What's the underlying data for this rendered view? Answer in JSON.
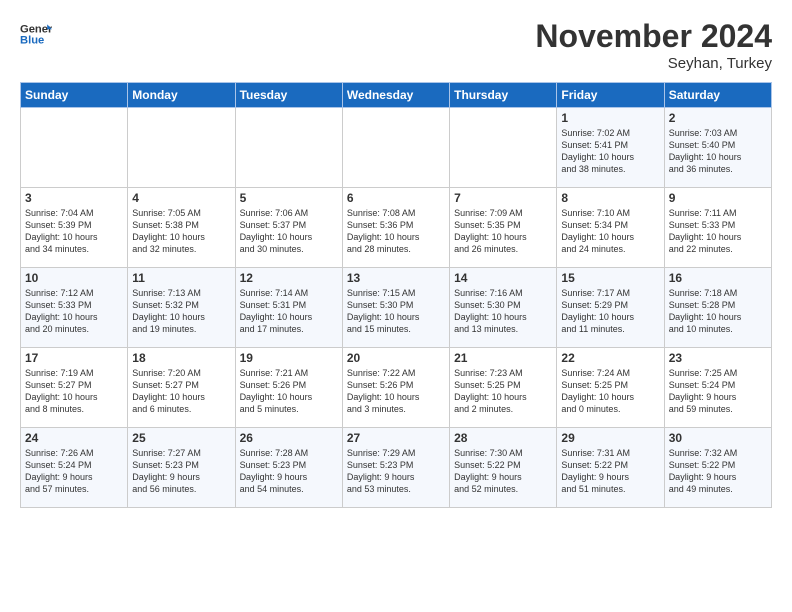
{
  "header": {
    "logo_line1": "General",
    "logo_line2": "Blue",
    "month_title": "November 2024",
    "subtitle": "Seyhan, Turkey"
  },
  "weekdays": [
    "Sunday",
    "Monday",
    "Tuesday",
    "Wednesday",
    "Thursday",
    "Friday",
    "Saturday"
  ],
  "weeks": [
    [
      {
        "day": "",
        "text": ""
      },
      {
        "day": "",
        "text": ""
      },
      {
        "day": "",
        "text": ""
      },
      {
        "day": "",
        "text": ""
      },
      {
        "day": "",
        "text": ""
      },
      {
        "day": "1",
        "text": "Sunrise: 7:02 AM\nSunset: 5:41 PM\nDaylight: 10 hours\nand 38 minutes."
      },
      {
        "day": "2",
        "text": "Sunrise: 7:03 AM\nSunset: 5:40 PM\nDaylight: 10 hours\nand 36 minutes."
      }
    ],
    [
      {
        "day": "3",
        "text": "Sunrise: 7:04 AM\nSunset: 5:39 PM\nDaylight: 10 hours\nand 34 minutes."
      },
      {
        "day": "4",
        "text": "Sunrise: 7:05 AM\nSunset: 5:38 PM\nDaylight: 10 hours\nand 32 minutes."
      },
      {
        "day": "5",
        "text": "Sunrise: 7:06 AM\nSunset: 5:37 PM\nDaylight: 10 hours\nand 30 minutes."
      },
      {
        "day": "6",
        "text": "Sunrise: 7:08 AM\nSunset: 5:36 PM\nDaylight: 10 hours\nand 28 minutes."
      },
      {
        "day": "7",
        "text": "Sunrise: 7:09 AM\nSunset: 5:35 PM\nDaylight: 10 hours\nand 26 minutes."
      },
      {
        "day": "8",
        "text": "Sunrise: 7:10 AM\nSunset: 5:34 PM\nDaylight: 10 hours\nand 24 minutes."
      },
      {
        "day": "9",
        "text": "Sunrise: 7:11 AM\nSunset: 5:33 PM\nDaylight: 10 hours\nand 22 minutes."
      }
    ],
    [
      {
        "day": "10",
        "text": "Sunrise: 7:12 AM\nSunset: 5:33 PM\nDaylight: 10 hours\nand 20 minutes."
      },
      {
        "day": "11",
        "text": "Sunrise: 7:13 AM\nSunset: 5:32 PM\nDaylight: 10 hours\nand 19 minutes."
      },
      {
        "day": "12",
        "text": "Sunrise: 7:14 AM\nSunset: 5:31 PM\nDaylight: 10 hours\nand 17 minutes."
      },
      {
        "day": "13",
        "text": "Sunrise: 7:15 AM\nSunset: 5:30 PM\nDaylight: 10 hours\nand 15 minutes."
      },
      {
        "day": "14",
        "text": "Sunrise: 7:16 AM\nSunset: 5:30 PM\nDaylight: 10 hours\nand 13 minutes."
      },
      {
        "day": "15",
        "text": "Sunrise: 7:17 AM\nSunset: 5:29 PM\nDaylight: 10 hours\nand 11 minutes."
      },
      {
        "day": "16",
        "text": "Sunrise: 7:18 AM\nSunset: 5:28 PM\nDaylight: 10 hours\nand 10 minutes."
      }
    ],
    [
      {
        "day": "17",
        "text": "Sunrise: 7:19 AM\nSunset: 5:27 PM\nDaylight: 10 hours\nand 8 minutes."
      },
      {
        "day": "18",
        "text": "Sunrise: 7:20 AM\nSunset: 5:27 PM\nDaylight: 10 hours\nand 6 minutes."
      },
      {
        "day": "19",
        "text": "Sunrise: 7:21 AM\nSunset: 5:26 PM\nDaylight: 10 hours\nand 5 minutes."
      },
      {
        "day": "20",
        "text": "Sunrise: 7:22 AM\nSunset: 5:26 PM\nDaylight: 10 hours\nand 3 minutes."
      },
      {
        "day": "21",
        "text": "Sunrise: 7:23 AM\nSunset: 5:25 PM\nDaylight: 10 hours\nand 2 minutes."
      },
      {
        "day": "22",
        "text": "Sunrise: 7:24 AM\nSunset: 5:25 PM\nDaylight: 10 hours\nand 0 minutes."
      },
      {
        "day": "23",
        "text": "Sunrise: 7:25 AM\nSunset: 5:24 PM\nDaylight: 9 hours\nand 59 minutes."
      }
    ],
    [
      {
        "day": "24",
        "text": "Sunrise: 7:26 AM\nSunset: 5:24 PM\nDaylight: 9 hours\nand 57 minutes."
      },
      {
        "day": "25",
        "text": "Sunrise: 7:27 AM\nSunset: 5:23 PM\nDaylight: 9 hours\nand 56 minutes."
      },
      {
        "day": "26",
        "text": "Sunrise: 7:28 AM\nSunset: 5:23 PM\nDaylight: 9 hours\nand 54 minutes."
      },
      {
        "day": "27",
        "text": "Sunrise: 7:29 AM\nSunset: 5:23 PM\nDaylight: 9 hours\nand 53 minutes."
      },
      {
        "day": "28",
        "text": "Sunrise: 7:30 AM\nSunset: 5:22 PM\nDaylight: 9 hours\nand 52 minutes."
      },
      {
        "day": "29",
        "text": "Sunrise: 7:31 AM\nSunset: 5:22 PM\nDaylight: 9 hours\nand 51 minutes."
      },
      {
        "day": "30",
        "text": "Sunrise: 7:32 AM\nSunset: 5:22 PM\nDaylight: 9 hours\nand 49 minutes."
      }
    ]
  ]
}
